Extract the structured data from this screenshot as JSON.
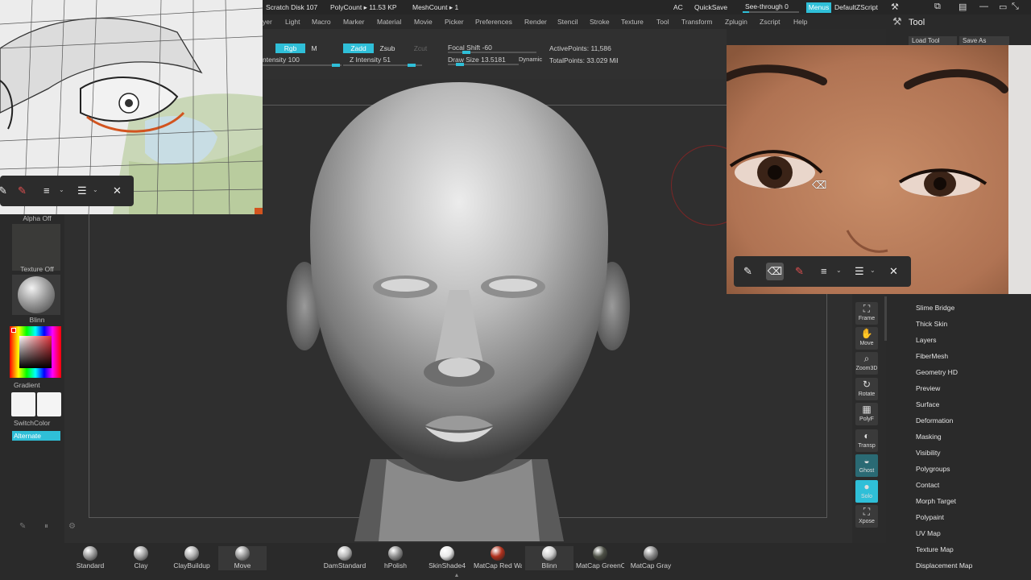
{
  "status": {
    "scratch": "Scratch Disk 107",
    "polycount": "PolyCount ▸ 11.53 KP",
    "meshcount": "MeshCount ▸ 1",
    "ac": "AC",
    "quicksave": "QuickSave",
    "seethrough": "See-through  0",
    "menus": "Menus",
    "script": "DefaultZScript"
  },
  "menu": [
    "yer",
    "Light",
    "Macro",
    "Marker",
    "Material",
    "Movie",
    "Picker",
    "Preferences",
    "Render",
    "Stencil",
    "Stroke",
    "Texture",
    "Tool",
    "Transform",
    "Zplugin",
    "Zscript",
    "Help"
  ],
  "toolbar": {
    "rgb": "Rgb",
    "m": "M",
    "zadd": "Zadd",
    "zsub": "Zsub",
    "zcut": "Zcut",
    "intensity": "ntensity 100",
    "z_intensity": "Z Intensity 51",
    "focal_shift": "Focal Shift -60",
    "draw_size": "Draw Size 13.5181",
    "dynamic": "Dynamic",
    "active_points": "ActivePoints: 11,586",
    "total_points": "TotalPoints: 33.029 Mil"
  },
  "left": {
    "alpha": "Alpha Off",
    "texture": "Texture Off",
    "material": "Blinn",
    "gradient": "Gradient",
    "switch_color": "SwitchColor",
    "alternate": "Alternate"
  },
  "tool_panel": {
    "title": "Tool",
    "load_tool": "Load Tool",
    "save_as": "Save As",
    "items": [
      "Slime Bridge",
      "Thick Skin",
      "Layers",
      "FiberMesh",
      "Geometry HD",
      "Preview",
      "Surface",
      "Deformation",
      "Masking",
      "Visibility",
      "Polygroups",
      "Contact",
      "Morph Target",
      "Polypaint",
      "UV Map",
      "Texture Map",
      "Displacement Map"
    ]
  },
  "vtools": [
    "Frame",
    "Move",
    "Zoom3D",
    "Rotate",
    "PolyF",
    "Transp",
    "Ghost",
    "Solo",
    "Xpose"
  ],
  "brushes": [
    {
      "label": "Standard",
      "color": "#9a9a9a"
    },
    {
      "label": "Clay",
      "color": "#a5a5a5"
    },
    {
      "label": "ClayBuildup",
      "color": "#b0b0b0"
    },
    {
      "label": "Move",
      "color": "#999999"
    },
    {
      "label": "DamStandard",
      "color": "#b8b8b8"
    },
    {
      "label": "hPolish",
      "color": "#8e8e8e"
    },
    {
      "label": "SkinShade4",
      "color": "#e9e9e9"
    },
    {
      "label": "MatCap Red Wa",
      "color": "#b0301c"
    },
    {
      "label": "Blinn",
      "color": "#cfcfcf"
    },
    {
      "label": "MatCap GreenC",
      "color": "#4d5046"
    },
    {
      "label": "MatCap Gray",
      "color": "#8a8a8a"
    }
  ],
  "colors": {
    "accent": "#2fbfd8",
    "panel": "#2a2a2a",
    "canvas": "#2f2f2f"
  }
}
